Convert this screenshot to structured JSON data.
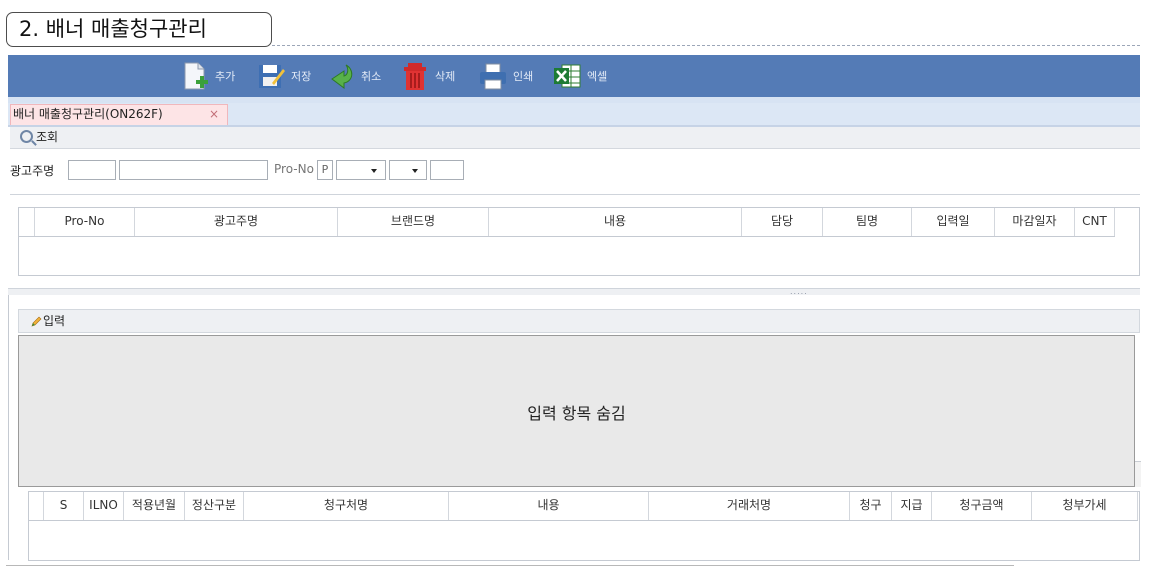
{
  "section_title": "2. 배너 매출청구관리",
  "toolbar": {
    "items": [
      {
        "label": "추가",
        "icon": "add-document-icon"
      },
      {
        "label": "저장",
        "icon": "save-icon"
      },
      {
        "label": "취소",
        "icon": "undo-arrow-icon"
      },
      {
        "label": "삭제",
        "icon": "trash-icon"
      },
      {
        "label": "인쇄",
        "icon": "printer-icon"
      },
      {
        "label": "엑셀",
        "icon": "excel-icon"
      }
    ],
    "color": "#547bb6"
  },
  "document_tab": {
    "label": "배너 매출청구관리(ON262F)",
    "close": "×"
  },
  "search_panel": {
    "title": "조회",
    "advertiser_label": "광고주명",
    "advertiser_code": "",
    "advertiser_name": "",
    "prono_label": "Pro-No",
    "prono_prefix": "P",
    "select1": "",
    "select2": "",
    "prono_extra": ""
  },
  "grid1": {
    "columns": [
      "",
      "Pro-No",
      "광고주명",
      "브랜드명",
      "내용",
      "담당",
      "팀명",
      "입력일",
      "마감일자",
      "CNT"
    ],
    "rows": []
  },
  "splitter_handle": ".....",
  "input_panel": {
    "title": "입력",
    "hidden_message": "입력 항목 숨김"
  },
  "grid2": {
    "columns": [
      "",
      "S",
      "ILNO",
      "적용년월",
      "정산구분",
      "청구처명",
      "내용",
      "거래처명",
      "청구",
      "지급",
      "청구금액",
      "청부가세"
    ],
    "rows": []
  }
}
